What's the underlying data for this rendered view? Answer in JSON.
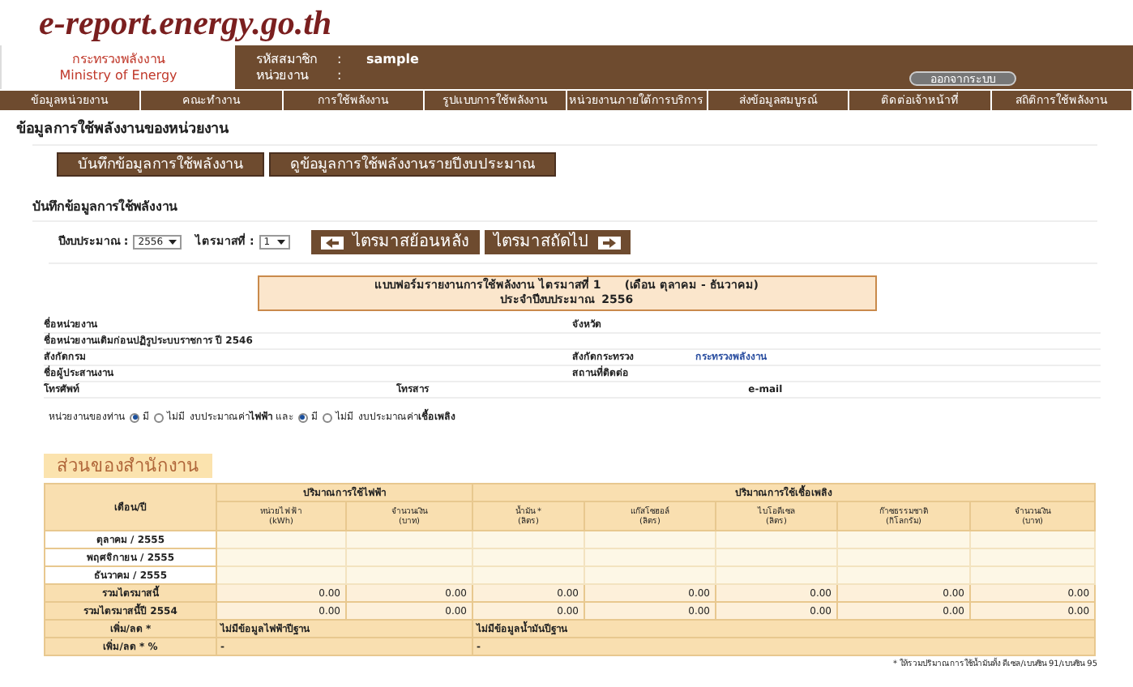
{
  "logo": "e-report.energy.go.th",
  "header": {
    "ministry_th": "กระทรวงพลังงาน",
    "ministry_en": "Ministry of Energy",
    "fields": [
      {
        "label": "รหัสสมาชิก",
        "sep": ":",
        "value": "sample"
      },
      {
        "label": "หน่วยงาน",
        "sep": ":"
      }
    ],
    "logout": "ออกจากระบบ"
  },
  "nav": [
    {
      "label": "ข้อมูลหน่วยงาน"
    },
    {
      "label": "คณะทำงาน"
    },
    {
      "label": "การใช้พลังงาน"
    },
    {
      "label": "รูปแบบการใช้พลังงาน"
    },
    {
      "label": "หน่วยงานภายใต้การบริการ"
    },
    {
      "label": "ส่งข้อมูลสมบูรณ์"
    },
    {
      "label": "ติดต่อเจ้าหน้าที่"
    },
    {
      "label": "สถิติการใช้พลังงาน"
    }
  ],
  "page_title": "ข้อมูลการใช้พลังงานของหน่วยงาน",
  "action_buttons": [
    "บันทึกข้อมูลการใช้พลังงาน",
    "ดูข้อมูลการใช้พลังงานรายปีงบประมาณ"
  ],
  "section_title": "บันทึกข้อมูลการใช้พลังงาน",
  "filters": {
    "year_label": "ปีงบประมาณ :",
    "year": "2556",
    "quarter_label": "ไตรมาสที่ :",
    "quarter": "1",
    "prev": "ไตรมาสย้อนหลัง",
    "next": "ไตรมาสถัดไป"
  },
  "form_title": [
    "แบบฟอร์มรายงานการใช้พลังงาน ไตรมาสที่ 1      (เดือน ตุลาคม - ธันวาคม)",
    "ประจำปีงบประมาณ  2556"
  ],
  "info_rows": [
    [
      {
        "label": "ชื่อหน่วยงาน"
      },
      {
        "label": "จังหวัด"
      }
    ],
    [
      {
        "label": "ชื่อหน่วยงานเดิมก่อนปฏิรูประบบราชการ ปี 2546"
      }
    ],
    [
      {
        "label": "สังกัดกรม"
      },
      {
        "label": "สังกัดกระทรวง",
        "value": "กระทรวงพลังงาน"
      }
    ],
    [
      {
        "label": "ชื่อผู้ประสานงาน"
      },
      {
        "label": "สถานที่ติดต่อ"
      }
    ],
    [
      {
        "label": "โทรศัพท์"
      },
      {
        "label": "โทรสาร"
      },
      {
        "label": "e-mail"
      }
    ]
  ],
  "budget": {
    "label": "หน่วยงานของท่าน",
    "groups": [
      {
        "options": [
          {
            "label": "มี",
            "selected": true
          },
          {
            "label": "ไม่มี",
            "selected": false
          }
        ],
        "text": "งบประมาณค่า**ไฟฟ้า** และ"
      },
      {
        "options": [
          {
            "label": "มี",
            "selected": true
          },
          {
            "label": "ไม่มี",
            "selected": false
          }
        ],
        "text": "งบประมาณค่า**เชื้อเพลิง**"
      }
    ]
  },
  "tab": "ส่วนของสำนักงาน",
  "table": {
    "first_header": "เดือน/ปี",
    "groups": [
      {
        "title": "ปริมาณการใช้ไฟฟ้า",
        "columns": [
          [
            "หน่วยไฟฟ้า",
            "(kWh)"
          ],
          [
            "จำนวนเงิน",
            "(บาท)"
          ]
        ]
      },
      {
        "title": "ปริมาณการใช้เชื้อเพลิง",
        "columns": [
          [
            "น้ำมัน *",
            "(ลิตร)"
          ],
          [
            "แก๊สโซฮอล์",
            "(ลิตร)"
          ],
          [
            "ไบโอดีเซล",
            "(ลิตร)"
          ],
          [
            "ก๊าซธรรมชาติ",
            "(กิโลกรัม)"
          ],
          [
            "จำนวนเงิน",
            "(บาท)"
          ]
        ]
      }
    ],
    "rows": [
      {
        "kind": "input",
        "label": "ตุลาคม / 2555"
      },
      {
        "kind": "input",
        "label": "พฤศจิกายน / 2555"
      },
      {
        "kind": "input",
        "label": "ธันวาคม / 2555"
      },
      {
        "kind": "total",
        "label": "รวมไตรมาสนี้",
        "cells": [
          "0.00",
          "0.00",
          "0.00",
          "0.00",
          "0.00",
          "0.00",
          "0.00"
        ]
      },
      {
        "kind": "total",
        "label": "รวมไตรมาสนี้ปี 2554",
        "cells": [
          "0.00",
          "0.00",
          "0.00",
          "0.00",
          "0.00",
          "0.00",
          "0.00"
        ]
      },
      {
        "kind": "note",
        "label": "เพิ่ม/ลด *",
        "cells": [
          "ไม่มีข้อมูลไฟฟ้าปีฐาน",
          "ไม่มีข้อมูลน้ำมันปีฐาน"
        ]
      },
      {
        "kind": "note",
        "label": "เพิ่ม/ลด * %",
        "cells": [
          "-",
          "-"
        ]
      }
    ]
  },
  "footnote": "* ให้รวมปริมาณการใช้น้ำมันทั้ง ดีเซล/เบนซิน 91/เบนซิน 95"
}
